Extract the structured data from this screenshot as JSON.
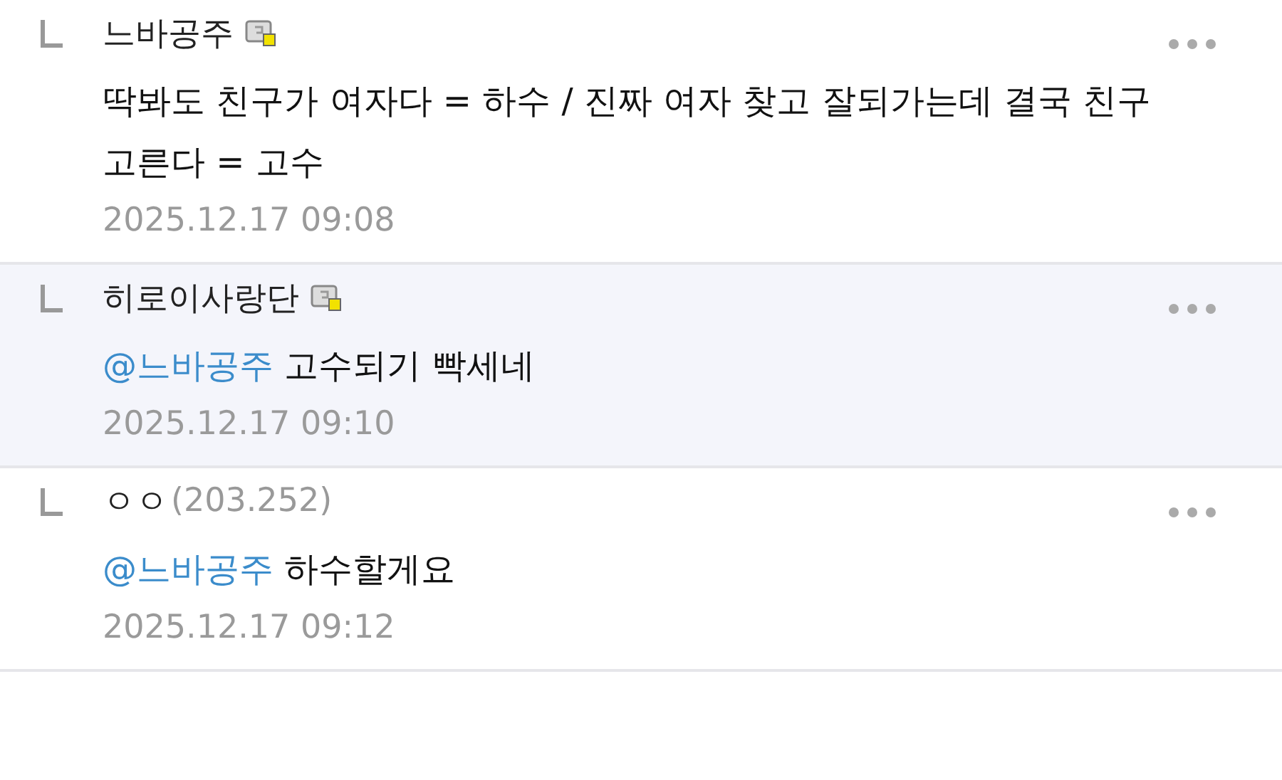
{
  "comments": [
    {
      "author": "느바공주",
      "member": true,
      "highlighted": false,
      "body": "딱봐도 친구가 여자다 = 하수 / 진짜 여자 찾고 잘되가는데 결국 친구 고른다 = 고수",
      "date": "2025.12.17 09:08"
    },
    {
      "author": "히로이사랑단",
      "member": true,
      "highlighted": true,
      "mention": "@느바공주",
      "body": "고수되기 빡세네",
      "date": "2025.12.17 09:10"
    },
    {
      "author": "ㅇㅇ",
      "ip": "(203.252)",
      "member": false,
      "highlighted": false,
      "mention": "@느바공주",
      "body": "하수할게요",
      "date": "2025.12.17 09:12"
    }
  ]
}
